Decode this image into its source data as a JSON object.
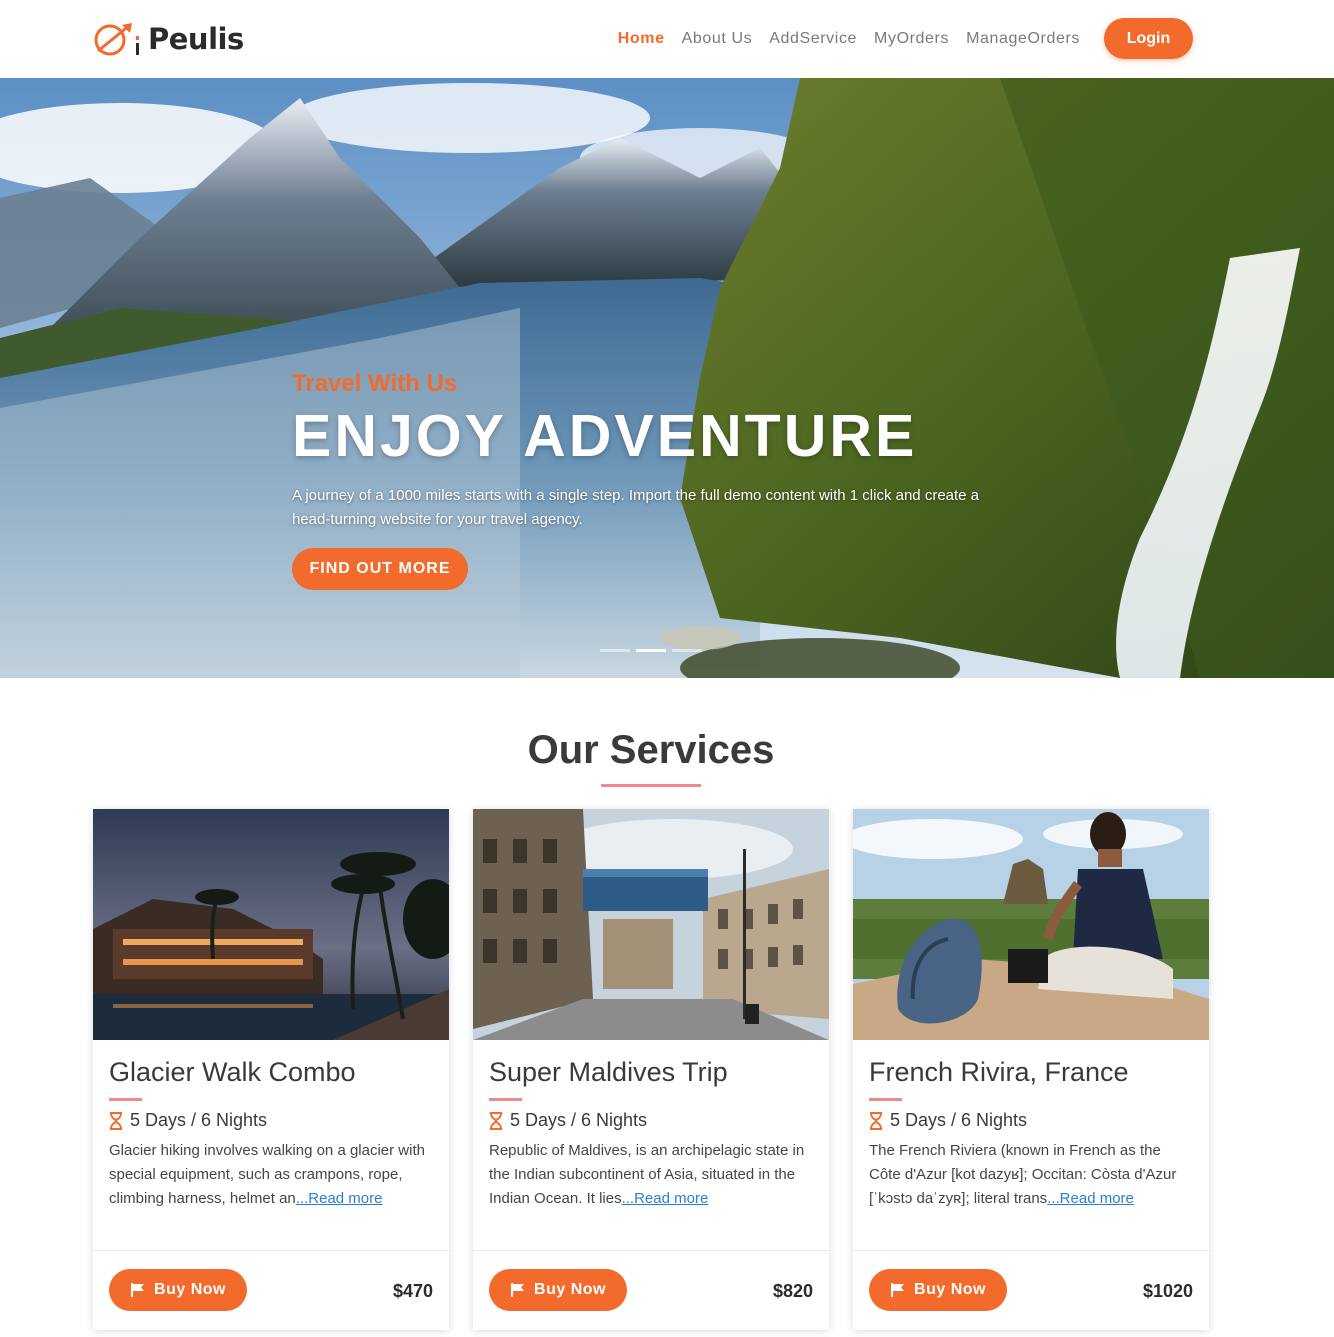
{
  "brand": {
    "name": "Peulis",
    "accent": "#f26b2c"
  },
  "nav": {
    "links": [
      "Home",
      "About Us",
      "AddService",
      "MyOrders",
      "ManageOrders"
    ],
    "login_label": "Login"
  },
  "hero": {
    "subtitle": "Travel With Us",
    "title": "ENJOY ADVENTURE",
    "text": "A journey of a 1000 miles starts with a single step. Import the full demo content with 1 click and create a head-turning website for your travel agency.",
    "button_label": "FIND OUT MORE",
    "slides": 3,
    "active_slide": 2
  },
  "services": {
    "title": "Our Services",
    "cards": [
      {
        "title": "Glacier Walk Combo",
        "duration": "5 Days / 6 Nights",
        "description": "Glacier hiking involves walking on a glacier with special equipment, such as crampons, rope, climbing harness, helmet an",
        "read_more": "...Read more",
        "button_label": "Buy Now",
        "price": "$470",
        "image": "resort-pool-palms-night"
      },
      {
        "title": "Super Maldives Trip",
        "duration": "5 Days / 6 Nights",
        "description": "Republic of Maldives, is an archipelagic state in the Indian subcontinent of Asia, situated in the Indian Ocean. It lies",
        "read_more": "...Read more",
        "button_label": "Buy Now",
        "price": "$820",
        "image": "city-street-bridge"
      },
      {
        "title": "French Rivira, France",
        "duration": "5 Days / 6 Nights",
        "description": "The French Riviera (known in French as the Côte d'Azur [kot dazyʁ]; Occitan: Còsta d'Azur [ˈkɔstɔ daˈzyʀ]; literal trans",
        "read_more": "...Read more",
        "button_label": "Buy Now",
        "price": "$1020",
        "image": "hiker-mountain-view"
      }
    ]
  }
}
